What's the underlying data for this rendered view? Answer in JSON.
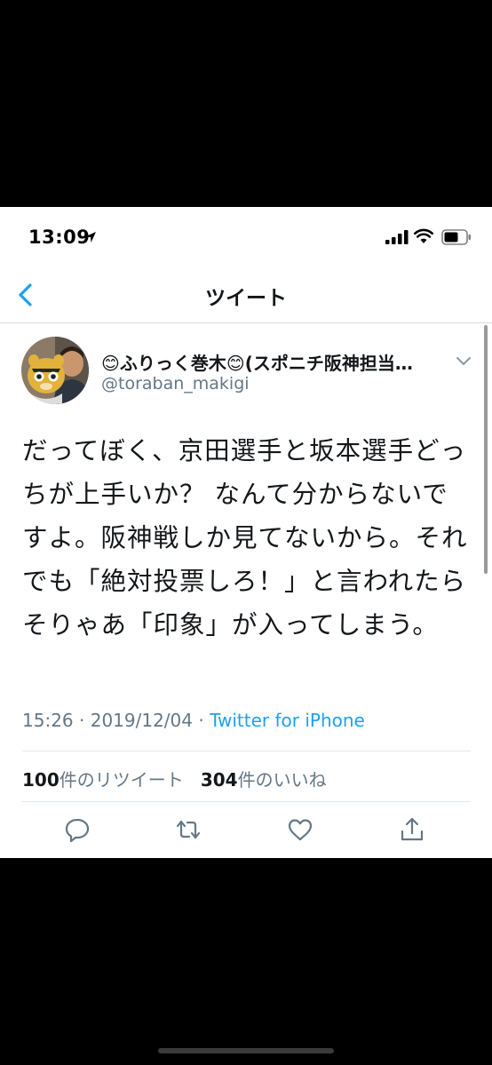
{
  "status_bar": {
    "time": "13:09"
  },
  "nav": {
    "title": "ツイート"
  },
  "tweet": {
    "display_name": "😊ふりっく巻木😊(スポニチ阪神担当…",
    "handle": "@toraban_makigi",
    "text": "だってぼく、京田選手と坂本選手どっちが上手いか？ なんて分からないですよ。阪神戦しか見てないから。それでも「絶対投票しろ！」と言われたらそりゃあ「印象」が入ってしまう。",
    "time": "15:26",
    "separator": "·",
    "date": "2019/12/04",
    "source": "Twitter for iPhone",
    "retweet_count": "100",
    "retweet_label": "件のリツイート",
    "like_count": "304",
    "like_label": "件のいいね"
  },
  "icons": {
    "back": "chevron-left-icon",
    "caret": "chevron-down-icon",
    "reply": "reply-icon",
    "retweet": "retweet-icon",
    "like": "heart-icon",
    "share": "share-icon"
  },
  "colors": {
    "accent": "#1da1f2",
    "text": "#14171a",
    "secondary": "#657786",
    "icon": "#657786"
  }
}
